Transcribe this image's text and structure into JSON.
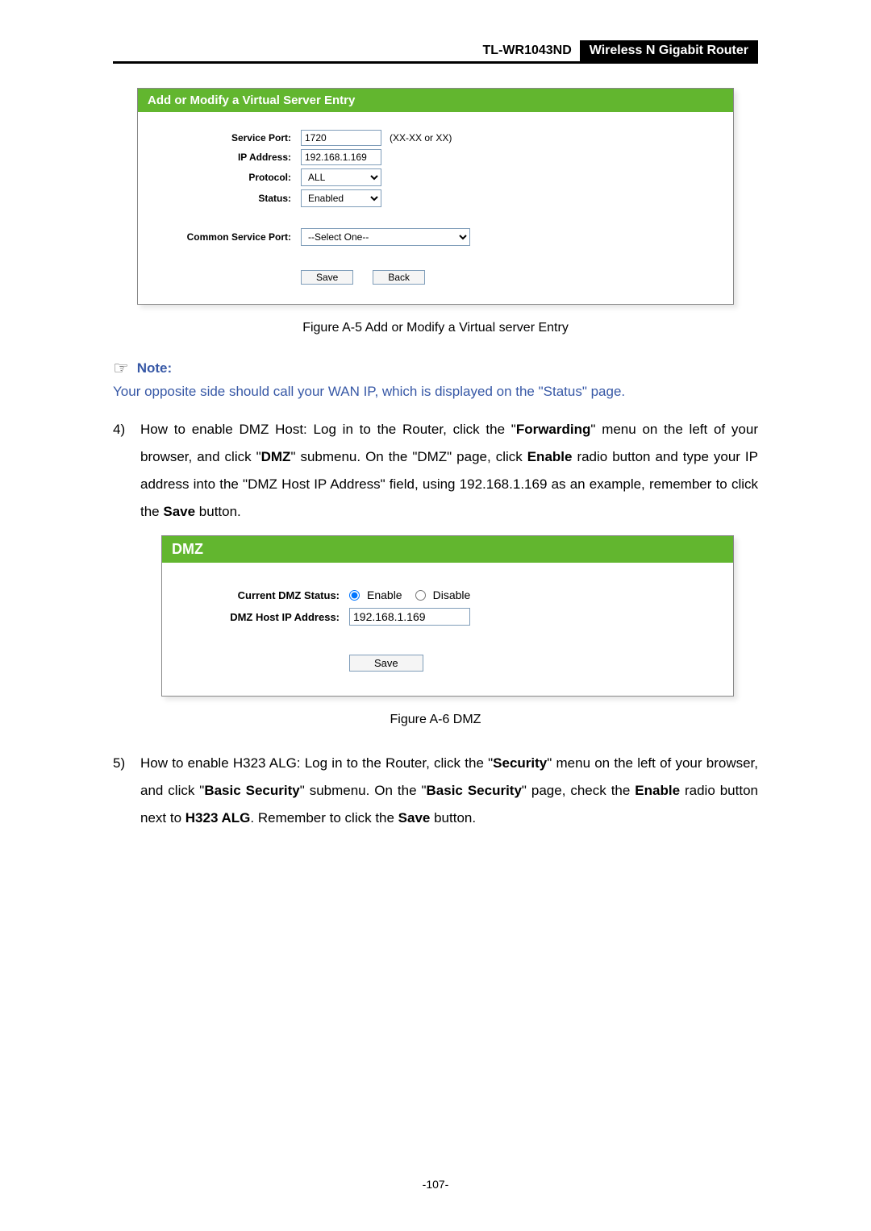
{
  "header": {
    "model": "TL-WR1043ND",
    "product": "Wireless N Gigabit Router"
  },
  "panel1": {
    "title": "Add or Modify a Virtual Server Entry",
    "service_port_label": "Service Port:",
    "service_port_value": "1720",
    "service_port_hint": "(XX-XX or XX)",
    "ip_label": "IP Address:",
    "ip_value": "192.168.1.169",
    "protocol_label": "Protocol:",
    "protocol_value": "ALL",
    "status_label": "Status:",
    "status_value": "Enabled",
    "common_label": "Common Service Port:",
    "common_value": "--Select One--",
    "save": "Save",
    "back": "Back"
  },
  "caption1": "Figure A-5    Add or Modify a Virtual server Entry",
  "note_label": "Note:",
  "note_text": "Your opposite side should call your WAN IP, which is displayed on the \"Status\" page.",
  "item4": {
    "num": "4)",
    "p1a": "How to enable DMZ Host: Log in to the Router, click the \"",
    "b1": "Forwarding",
    "p1b": "\" menu on the left of your browser, and click \"",
    "b2": "DMZ",
    "p1c": "\" submenu. On the \"DMZ\" page, click ",
    "b3": "Enable",
    "p1d": " radio button and type your IP address into the \"DMZ Host IP Address\" field, using 192.168.1.169 as an example, remember to click the ",
    "b4": "Save",
    "p1e": " button."
  },
  "panel2": {
    "title": "DMZ",
    "status_label": "Current DMZ Status:",
    "enable": "Enable",
    "disable": "Disable",
    "host_label": "DMZ Host IP Address:",
    "host_value": "192.168.1.169",
    "save": "Save"
  },
  "caption2": "Figure A-6    DMZ",
  "item5": {
    "num": "5)",
    "p1a": "How to enable H323 ALG: Log in to the Router, click the \"",
    "b1": "Security",
    "p1b": "\" menu on the left of your browser, and click \"",
    "b2": "Basic Security",
    "p1c": "\" submenu. On the \"",
    "b3": "Basic Security",
    "p1d": "\" page, check the ",
    "b4": "Enable",
    "p1e": " radio button next to ",
    "b5": "H323 ALG",
    "p1f": ". Remember to click the ",
    "b6": "Save",
    "p1g": " button."
  },
  "page_num": "-107-"
}
